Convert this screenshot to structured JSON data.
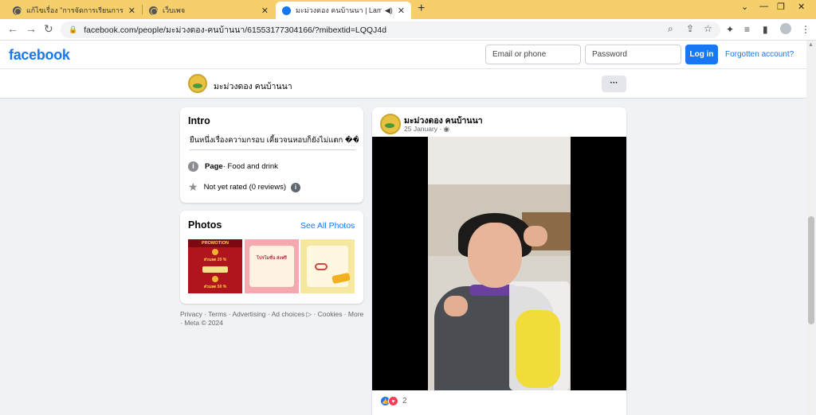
{
  "browser": {
    "tabs": [
      {
        "title": "แก้ไขเรื่อง \"การจัดการเรียนการสอน วิชา",
        "close": "✕"
      },
      {
        "title": "เว็บเพจ",
        "close": "✕"
      },
      {
        "title": "มะม่วงดอง คนบ้านนา | Lampang",
        "close": "✕",
        "audio": "◀)"
      }
    ],
    "new_tab": "+",
    "window_controls": {
      "dropdown": "⌄",
      "minimize": "—",
      "restore": "❐",
      "close": "✕"
    },
    "nav": {
      "back": "←",
      "forward": "→",
      "reload": "↻"
    },
    "url": "facebook.com/people/มะม่วงดอง-คนบ้านนา/61553177304166/?mibextid=LQQJ4d",
    "lock": "🔒",
    "omnibox_icons": {
      "zoom": "⌕",
      "share": "⇪",
      "bookmark": "☆"
    },
    "toolbar_icons": {
      "extensions": "✦",
      "media": "≡",
      "sidepanel": "▮",
      "menu": "⋮"
    }
  },
  "fb_header": {
    "logo": "facebook",
    "email_placeholder": "Email or phone",
    "password_placeholder": "Password",
    "login_label": "Log in",
    "forgot_label": "Forgotten account?"
  },
  "page": {
    "name": "มะม่วงดอง คนบ้านนา",
    "more_label": "···"
  },
  "intro": {
    "title": "Intro",
    "bio": "ยืนหนึ่งเรื่องความกรอบ เคี้ยวจนหอบก็ยังไม่แตก ��",
    "category_bold": "Page",
    "category_rest": " · Food and drink",
    "rating": "Not yet rated (0 reviews)",
    "info_glyph": "i"
  },
  "photos": {
    "title": "Photos",
    "see_all": "See All Photos",
    "p1_band": "PROMOTION",
    "p1_top": "ส่วนลด 20 %",
    "p1_bottom": "ส่วนลด 50 %",
    "p2_text": "โปรโมชั่น ส่งฟรี",
    "p3_text": ""
  },
  "footer": {
    "text": "Privacy · Terms · Advertising · Ad choices ▷ · Cookies · More · Meta © 2024"
  },
  "post": {
    "author": "มะม่วงดอง คนบ้านนา",
    "date": "25 January · ◉",
    "reaction_count": "2",
    "like_glyph": "👍",
    "love_glyph": "♥"
  }
}
